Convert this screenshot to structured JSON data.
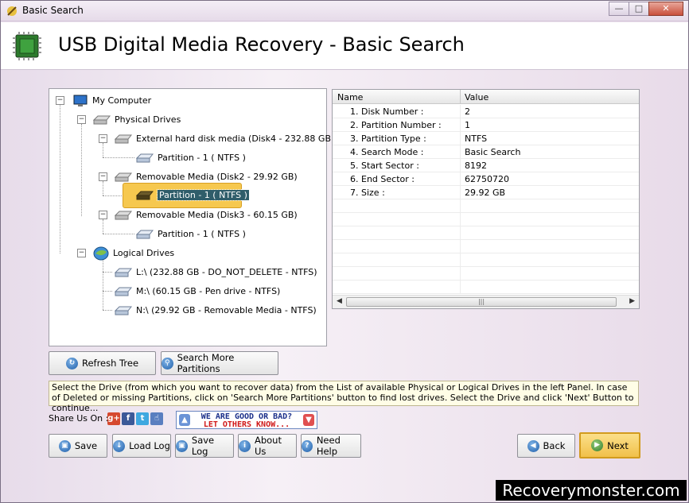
{
  "window": {
    "title": "Basic Search"
  },
  "header": {
    "title": "USB Digital Media Recovery - Basic Search"
  },
  "tree": {
    "root": "My Computer",
    "physical": "Physical Drives",
    "disk4": "External hard disk media (Disk4 - 232.88 GB)",
    "disk4_p1": "Partition - 1 ( NTFS )",
    "disk2": "Removable Media (Disk2 - 29.92 GB)",
    "disk2_p1": "Partition - 1 ( NTFS )",
    "disk3": "Removable Media (Disk3 - 60.15 GB)",
    "disk3_p1": "Partition - 1 ( NTFS )",
    "logical": "Logical Drives",
    "drive_l": "L:\\ (232.88 GB - DO_NOT_DELETE - NTFS)",
    "drive_m": "M:\\ (60.15 GB - Pen drive - NTFS)",
    "drive_n": "N:\\ (29.92 GB - Removable Media - NTFS)"
  },
  "grid": {
    "headers": [
      "Name",
      "Value"
    ],
    "rows": [
      {
        "name": "1. Disk Number :",
        "value": "2"
      },
      {
        "name": "2. Partition Number :",
        "value": "1"
      },
      {
        "name": "3. Partition Type :",
        "value": "NTFS"
      },
      {
        "name": "4. Search Mode :",
        "value": "Basic Search"
      },
      {
        "name": "5. Start Sector :",
        "value": "8192"
      },
      {
        "name": "6. End Sector :",
        "value": "62750720"
      },
      {
        "name": "7. Size :",
        "value": "29.92 GB"
      }
    ]
  },
  "buttons": {
    "refresh": "Refresh Tree",
    "search_more": "Search More Partitions",
    "save": "Save",
    "load_log": "Load Log",
    "save_log": "Save Log",
    "about": "About Us",
    "help": "Need Help",
    "back": "Back",
    "next": "Next"
  },
  "info_text": "Select the Drive (from which you want to recover data) from the List of available Physical or Logical Drives in the left Panel. In case of Deleted or missing Partitions, click on 'Search More Partitions' button to find lost drives. Select the Drive and click 'Next' Button to continue...",
  "share": {
    "label": "Share Us On :"
  },
  "banner": {
    "line1": "WE ARE GOOD OR BAD?",
    "line2": "LET OTHERS KNOW..."
  },
  "watermark": "Recoverymonster.com",
  "colors": {
    "selection": "#f6c84f",
    "accent": "#1f5ea8"
  }
}
